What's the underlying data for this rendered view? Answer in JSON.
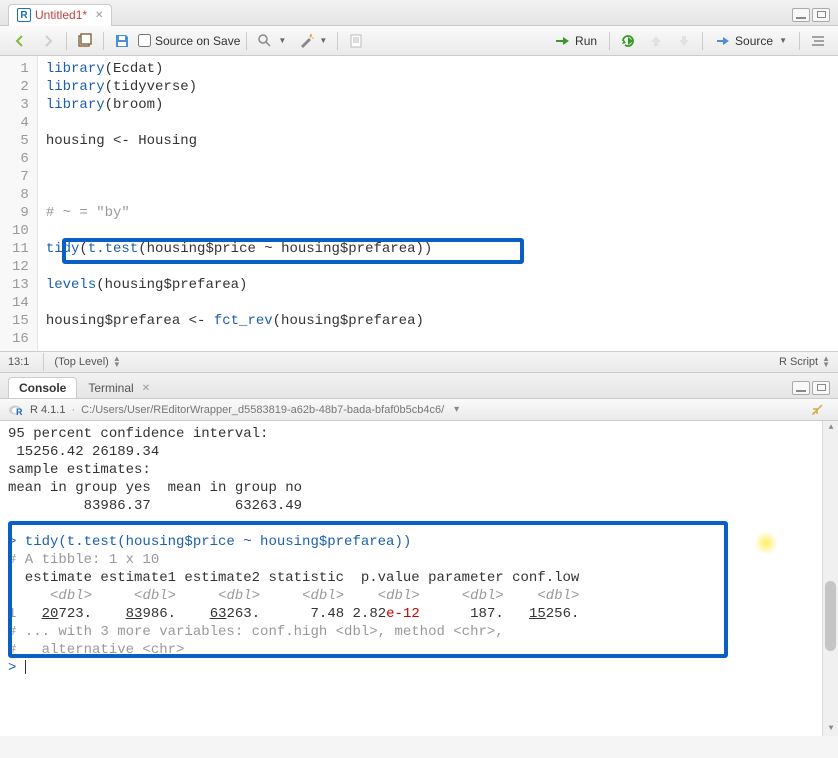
{
  "tab": {
    "title": "Untitled1*"
  },
  "toolbar": {
    "source_on_save": "Source on Save",
    "run": "Run",
    "source_btn": "Source"
  },
  "editor": {
    "lines": [
      {
        "n": "1",
        "html": "<span class='kw-fn'>library</span>(Ecdat)"
      },
      {
        "n": "2",
        "html": "<span class='kw-fn'>library</span>(tidyverse)"
      },
      {
        "n": "3",
        "html": "<span class='kw-fn'>library</span>(broom)"
      },
      {
        "n": "4",
        "html": ""
      },
      {
        "n": "5",
        "html": "housing &lt;- Housing"
      },
      {
        "n": "6",
        "html": ""
      },
      {
        "n": "7",
        "html": ""
      },
      {
        "n": "8",
        "html": ""
      },
      {
        "n": "9",
        "html": "<span class='con-gray'># ~ = \"by\"</span>"
      },
      {
        "n": "10",
        "html": ""
      },
      {
        "n": "11",
        "html": "<span class='kw-fn'>tidy</span>(<span class='kw-fn'>t.test</span>(housing$price ~ housing$prefarea))"
      },
      {
        "n": "12",
        "html": ""
      },
      {
        "n": "13",
        "html": "<span class='kw-fn'>levels</span>(housing$prefarea)"
      },
      {
        "n": "14",
        "html": ""
      },
      {
        "n": "15",
        "html": "housing$prefarea &lt;- <span class='kw-fn'>fct_rev</span>(housing$prefarea)"
      },
      {
        "n": "16",
        "html": ""
      }
    ]
  },
  "status": {
    "pos": "13:1",
    "scope": "(Top Level)",
    "type": "R Script"
  },
  "pane_tabs": {
    "console": "Console",
    "terminal": "Terminal"
  },
  "console_info": {
    "version": "R 4.1.1",
    "path": "C:/Users/User/REditorWrapper_d5583819-a62b-48b7-bada-bfaf0b5cb4c6/"
  },
  "console": {
    "lines": [
      {
        "html": "95 percent confidence interval:"
      },
      {
        "html": " 15256.42 26189.34"
      },
      {
        "html": "sample estimates:"
      },
      {
        "html": "mean in group yes  mean in group no"
      },
      {
        "html": "         83986.37          63263.49"
      },
      {
        "html": ""
      },
      {
        "html": "<span class='con-prompt'>&gt; tidy(t.test(housing$price ~ housing$prefarea))</span>"
      },
      {
        "html": "<span class='con-gray'># A tibble: 1 x 10</span>"
      },
      {
        "html": "  estimate estimate1 estimate2 statistic  p.value parameter conf.low"
      },
      {
        "html": "     <span class='con-italic'>&lt;dbl&gt;</span>     <span class='con-italic'>&lt;dbl&gt;</span>     <span class='con-italic'>&lt;dbl&gt;</span>     <span class='con-italic'>&lt;dbl&gt;</span>    <span class='con-italic'>&lt;dbl&gt;</span>     <span class='con-italic'>&lt;dbl&gt;</span>    <span class='con-italic'>&lt;dbl&gt;</span>"
      },
      {
        "html": "<span class='con-gray'>1</span>   <span class='con-underline'>20</span>723.    <span class='con-underline'>83</span>986.    <span class='con-underline'>63</span>263.      7.48 2.82<span class='con-red'>e-12</span>      187.   <span class='con-underline'>15</span>256."
      },
      {
        "html": "<span class='con-gray'># ... with 3 more variables: conf.high &lt;dbl&gt;, method &lt;chr&gt;,</span>"
      },
      {
        "html": "<span class='con-gray'>#   alternative &lt;chr&gt;</span>"
      },
      {
        "html": "<span class='con-prompt'>&gt; </span><span class='cursor-line'></span>"
      }
    ]
  },
  "chart_data": {
    "type": "table",
    "title": "tidy(t.test(housing$price ~ housing$prefarea))",
    "columns": [
      "estimate",
      "estimate1",
      "estimate2",
      "statistic",
      "p.value",
      "parameter",
      "conf.low"
    ],
    "rows": [
      [
        20723,
        83986,
        63263,
        7.48,
        2.82e-12,
        187,
        15256
      ]
    ],
    "conf_interval": [
      15256.42,
      26189.34
    ],
    "group_means": {
      "yes": 83986.37,
      "no": 63263.49
    }
  }
}
